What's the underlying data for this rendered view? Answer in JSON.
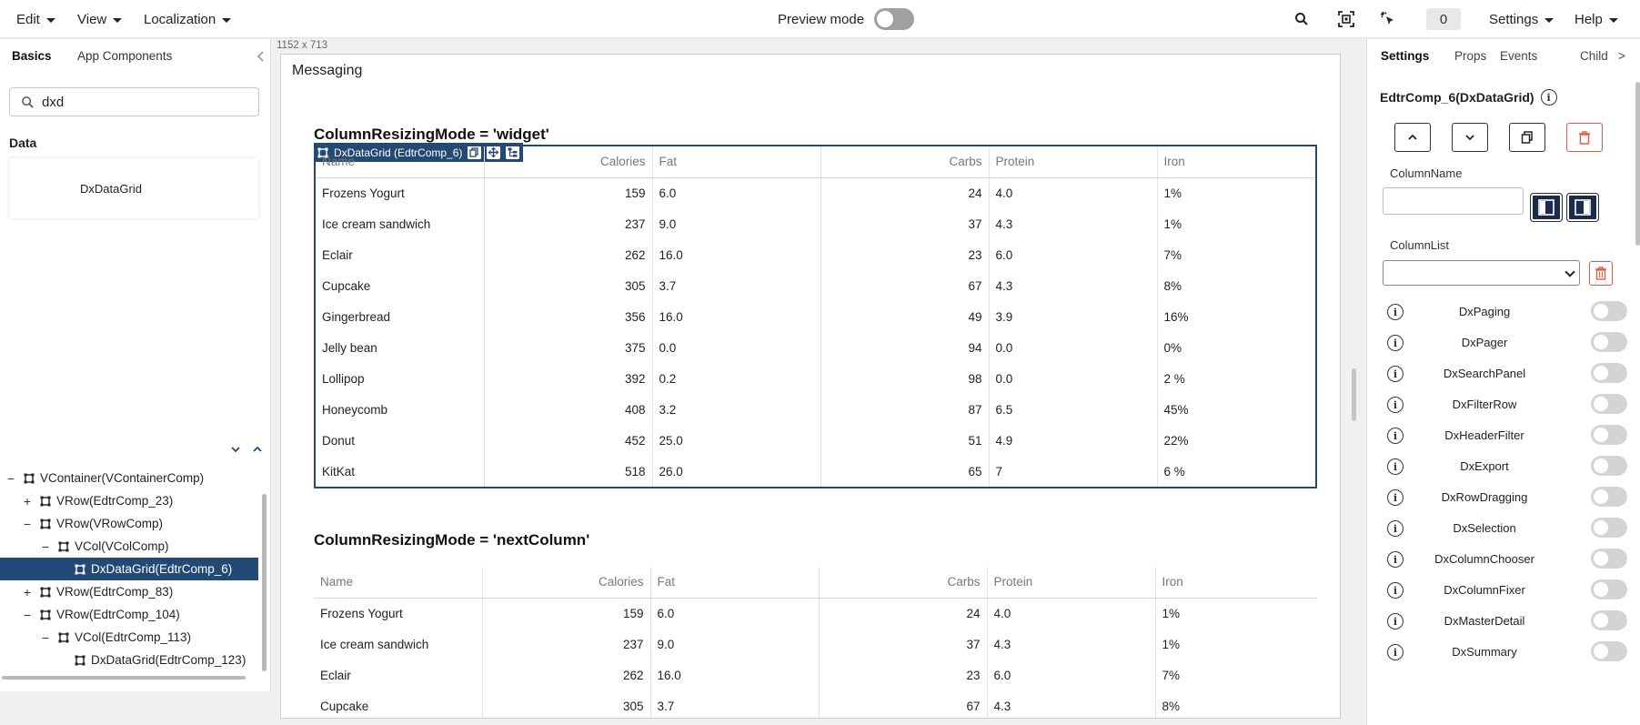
{
  "menubar": {
    "edit": "Edit",
    "view": "View",
    "localization": "Localization",
    "preview_label": "Preview mode",
    "counter": "0",
    "settings": "Settings",
    "help": "Help"
  },
  "left_panel": {
    "tabs": [
      "Basics",
      "App Components"
    ],
    "search_value": "dxd",
    "section": "Data",
    "component": "DxDataGrid",
    "tree": [
      {
        "toggle": "−",
        "label": "VContainer(VContainerComp)"
      },
      {
        "toggle": "+",
        "label": "VRow(EdtrComp_23)"
      },
      {
        "toggle": "−",
        "label": "VRow(VRowComp)"
      },
      {
        "toggle": "−",
        "label": "VCol(VColComp)"
      },
      {
        "toggle": "",
        "label": "DxDataGrid(EdtrComp_6)"
      },
      {
        "toggle": "+",
        "label": "VRow(EdtrComp_83)"
      },
      {
        "toggle": "−",
        "label": "VRow(EdtrComp_104)"
      },
      {
        "toggle": "−",
        "label": "VCol(EdtrComp_113)"
      },
      {
        "toggle": "",
        "label": "DxDataGrid(EdtrComp_123)"
      }
    ]
  },
  "canvas": {
    "size_label": "1152 x 713",
    "title": "Messaging",
    "heading1": "ColumnResizingMode = 'widget'",
    "selection_label": "DxDataGrid (EdtrComp_6)",
    "heading2": "ColumnResizingMode = 'nextColumn'",
    "columns": [
      "Name",
      "Calories",
      "Fat",
      "Carbs",
      "Protein",
      "Iron"
    ],
    "rows": [
      [
        "Frozens Yogurt",
        "159",
        "6.0",
        "24",
        "4.0",
        "1%"
      ],
      [
        "Ice cream sandwich",
        "237",
        "9.0",
        "37",
        "4.3",
        "1%"
      ],
      [
        "Eclair",
        "262",
        "16.0",
        "23",
        "6.0",
        "7%"
      ],
      [
        "Cupcake",
        "305",
        "3.7",
        "67",
        "4.3",
        "8%"
      ],
      [
        "Gingerbread",
        "356",
        "16.0",
        "49",
        "3.9",
        "16%"
      ],
      [
        "Jelly bean",
        "375",
        "0.0",
        "94",
        "0.0",
        "0%"
      ],
      [
        "Lollipop",
        "392",
        "0.2",
        "98",
        "0.0",
        "2 %"
      ],
      [
        "Honeycomb",
        "408",
        "3.2",
        "87",
        "6.5",
        "45%"
      ],
      [
        "Donut",
        "452",
        "25.0",
        "51",
        "4.9",
        "22%"
      ],
      [
        "KitKat",
        "518",
        "26.0",
        "65",
        "7",
        "6 %"
      ]
    ]
  },
  "right_panel": {
    "tabs": [
      "Settings",
      "Props",
      "Events",
      "Child"
    ],
    "more": ">",
    "component_title": "EdtrComp_6(DxDataGrid)",
    "column_name_label": "ColumnName",
    "column_list_label": "ColumnList",
    "plugins": [
      "DxPaging",
      "DxPager",
      "DxSearchPanel",
      "DxFilterRow",
      "DxHeaderFilter",
      "DxExport",
      "DxRowDragging",
      "DxSelection",
      "DxColumnChooser",
      "DxColumnFixer",
      "DxMasterDetail",
      "DxSummary"
    ]
  },
  "colors": {
    "selection": "#234a74",
    "danger": "#e05a45",
    "dark_button": "#1d2a4a"
  }
}
